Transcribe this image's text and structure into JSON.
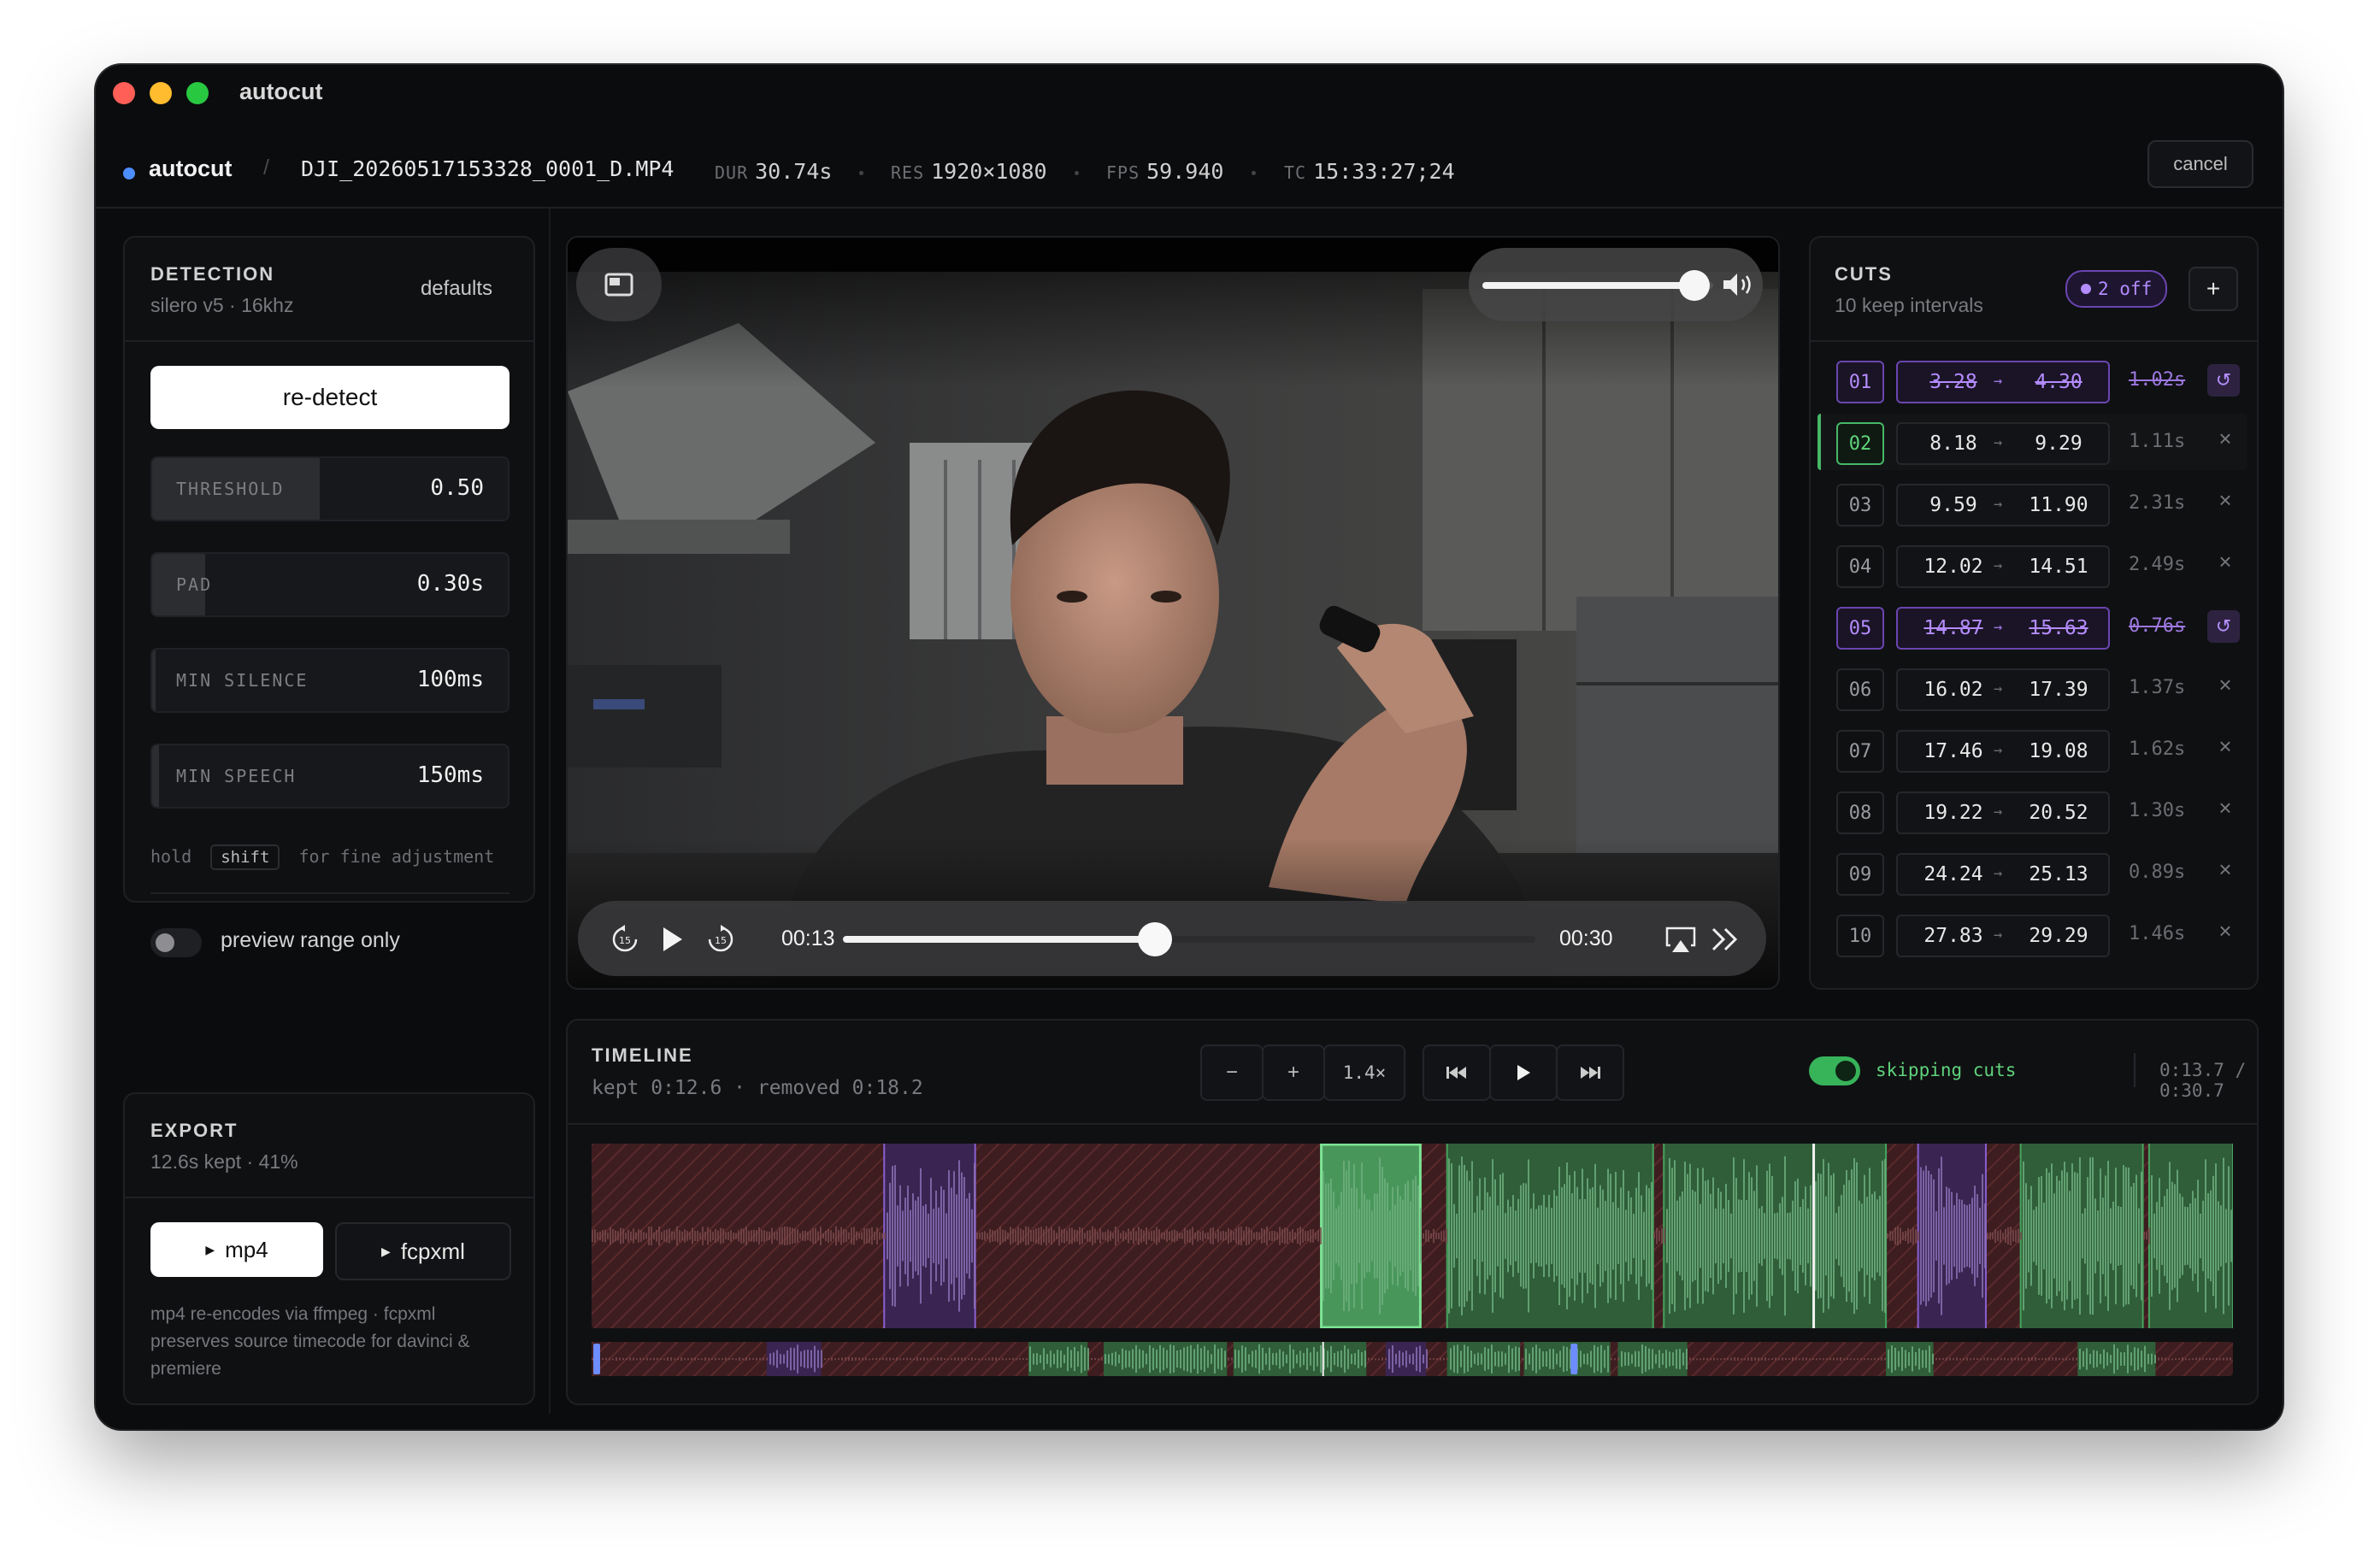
{
  "window": {
    "title": "autocut"
  },
  "header": {
    "app": "autocut",
    "separator": "/",
    "filename": "DJI_20260517153328_0001_D.MP4",
    "meta": [
      {
        "label": "DUR",
        "value": "30.74s"
      },
      {
        "label": "RES",
        "value": "1920×1080"
      },
      {
        "label": "FPS",
        "value": "59.940"
      },
      {
        "label": "TC",
        "value": "15:33:27;24"
      }
    ],
    "cancel_label": "cancel"
  },
  "detection": {
    "title": "DETECTION",
    "subtitle": "silero v5 · 16khz",
    "defaults_label": "defaults",
    "redetect_label": "re-detect",
    "sliders": [
      {
        "label": "THRESHOLD",
        "value": "0.50",
        "fill": 0.47
      },
      {
        "label": "PAD",
        "value": "0.30s",
        "fill": 0.15
      },
      {
        "label": "MIN SILENCE",
        "value": "100ms",
        "fill": 0.0
      },
      {
        "label": "MIN SPEECH",
        "value": "150ms",
        "fill": 0.02
      }
    ],
    "hint_prefix": "hold",
    "hint_key": "shift",
    "hint_suffix": "for fine adjustment",
    "preview_toggle_label": "preview range only",
    "preview_toggle_on": false
  },
  "export": {
    "title": "EXPORT",
    "subtitle": "12.6s kept · 41%",
    "mp4_label": "mp4",
    "fcpxml_label": "fcpxml",
    "note": "mp4 re-encodes via ffmpeg · fcpxml preserves source timecode for davinci & premiere"
  },
  "player": {
    "current_time": "00:13",
    "total_time": "00:30",
    "progress": 0.45,
    "volume": 0.92,
    "skip_back": "15",
    "skip_fwd": "15"
  },
  "cuts": {
    "title": "CUTS",
    "subtitle": "10 keep intervals",
    "off_badge": "2 off",
    "add_label": "+",
    "arrow": "→",
    "rows": [
      {
        "num": "01",
        "start": "3.28",
        "end": "4.30",
        "dur": "1.02s",
        "off": true
      },
      {
        "num": "02",
        "start": "8.18",
        "end": "9.29",
        "dur": "1.11s",
        "selected": true
      },
      {
        "num": "03",
        "start": "9.59",
        "end": "11.90",
        "dur": "2.31s"
      },
      {
        "num": "04",
        "start": "12.02",
        "end": "14.51",
        "dur": "2.49s"
      },
      {
        "num": "05",
        "start": "14.87",
        "end": "15.63",
        "dur": "0.76s",
        "off": true
      },
      {
        "num": "06",
        "start": "16.02",
        "end": "17.39",
        "dur": "1.37s"
      },
      {
        "num": "07",
        "start": "17.46",
        "end": "19.08",
        "dur": "1.62s"
      },
      {
        "num": "08",
        "start": "19.22",
        "end": "20.52",
        "dur": "1.30s"
      },
      {
        "num": "09",
        "start": "24.24",
        "end": "25.13",
        "dur": "0.89s"
      },
      {
        "num": "10",
        "start": "27.83",
        "end": "29.29",
        "dur": "1.46s"
      }
    ]
  },
  "timeline": {
    "title": "TIMELINE",
    "summary": "kept 0:12.6 · removed 0:18.2",
    "zoom_out": "−",
    "zoom_in": "+",
    "zoom_level": "1.4×",
    "skipping_label": "skipping cuts",
    "skipping_on": true,
    "position": "0:13.7 / 0:30.7",
    "duration_s": 30.74,
    "playhead_s": 13.7,
    "view_start_s": 0,
    "view_end_s": 18.4
  },
  "colors": {
    "accent_green": "#5fd37c",
    "accent_purple": "#b48cff",
    "removed_red": "#4a2224",
    "kept_green": "#2f6a3c",
    "dot_blue": "#4c8dff"
  },
  "icons": [
    "pip-icon",
    "volume-icon",
    "rewind-15-icon",
    "play-icon",
    "forward-15-icon",
    "airplay-icon",
    "double-chevron-icon",
    "skip-start-icon",
    "skip-end-icon",
    "close-icon",
    "undo-icon"
  ]
}
